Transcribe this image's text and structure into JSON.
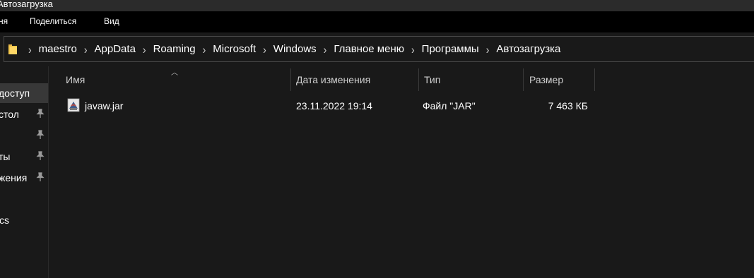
{
  "window": {
    "title": "Автозагрузка"
  },
  "ribbon": {
    "tabs": [
      {
        "label": "ня"
      },
      {
        "label": "Поделиться"
      },
      {
        "label": "Вид"
      }
    ]
  },
  "address": {
    "segments": [
      "maestro",
      "AppData",
      "Roaming",
      "Microsoft",
      "Windows",
      "Главное меню",
      "Программы",
      "Автозагрузка"
    ]
  },
  "nav": {
    "items": [
      {
        "label": "доступ",
        "selected": true,
        "pinned": false
      },
      {
        "label": "стол",
        "selected": false,
        "pinned": true
      },
      {
        "label": "",
        "selected": false,
        "pinned": true
      },
      {
        "label": "ты",
        "selected": false,
        "pinned": true
      },
      {
        "label": "жения",
        "selected": false,
        "pinned": true
      },
      {
        "label": "cs",
        "selected": false,
        "pinned": false
      }
    ]
  },
  "columns": {
    "name": "Имя",
    "date": "Дата изменения",
    "type": "Тип",
    "size": "Размер"
  },
  "files": [
    {
      "name": "javaw.jar",
      "date": "23.11.2022 19:14",
      "type": "Файл \"JAR\"",
      "size": "7 463 КБ",
      "icon": "java-jar-icon"
    }
  ]
}
